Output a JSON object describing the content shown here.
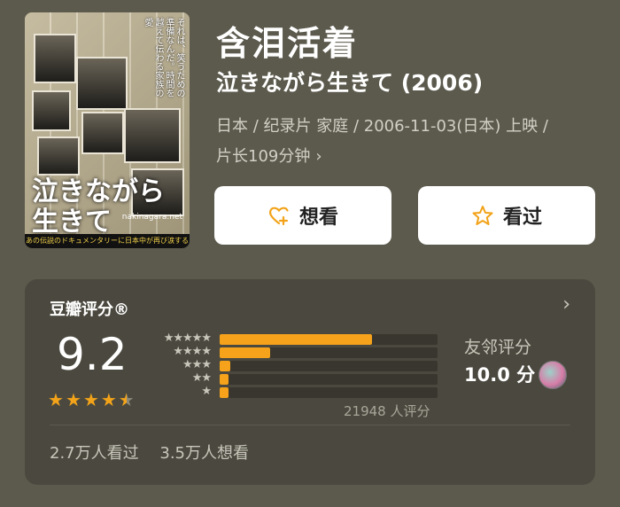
{
  "movie": {
    "title": "含泪活着",
    "original_title": "泣きながら生きて (2006)",
    "meta_line1": "日本 / 纪录片 家庭 / 2006-11-03(日本) 上映 /",
    "meta_line2": "片长109分钟",
    "poster": {
      "vertical_text": "それは、笑うための準備なんだ。時間を越えて伝わる家族の愛",
      "title": "泣きながら\n生きて",
      "site": "nakinagara.net",
      "footer": "あの伝説のドキュメンタリーに日本中が再び涙する"
    }
  },
  "actions": {
    "want_label": "想看",
    "watched_label": "看过",
    "want_icon": "heart-plus-icon",
    "watched_icon": "star-outline-icon",
    "accent": "#f2a319"
  },
  "rating": {
    "header": "豆瓣评分®",
    "score": "9.2",
    "stars_value": 4.5,
    "distribution_percent": [
      70,
      23,
      5,
      4,
      4
    ],
    "star_labels": [
      "★★★★★",
      "★★★★",
      "★★★",
      "★★",
      "★"
    ],
    "count": "21948 人评分",
    "friend_label": "友邻评分",
    "friend_score": "10.0 分",
    "watched": "2.7万人看过",
    "want": "3.5万人想看"
  }
}
